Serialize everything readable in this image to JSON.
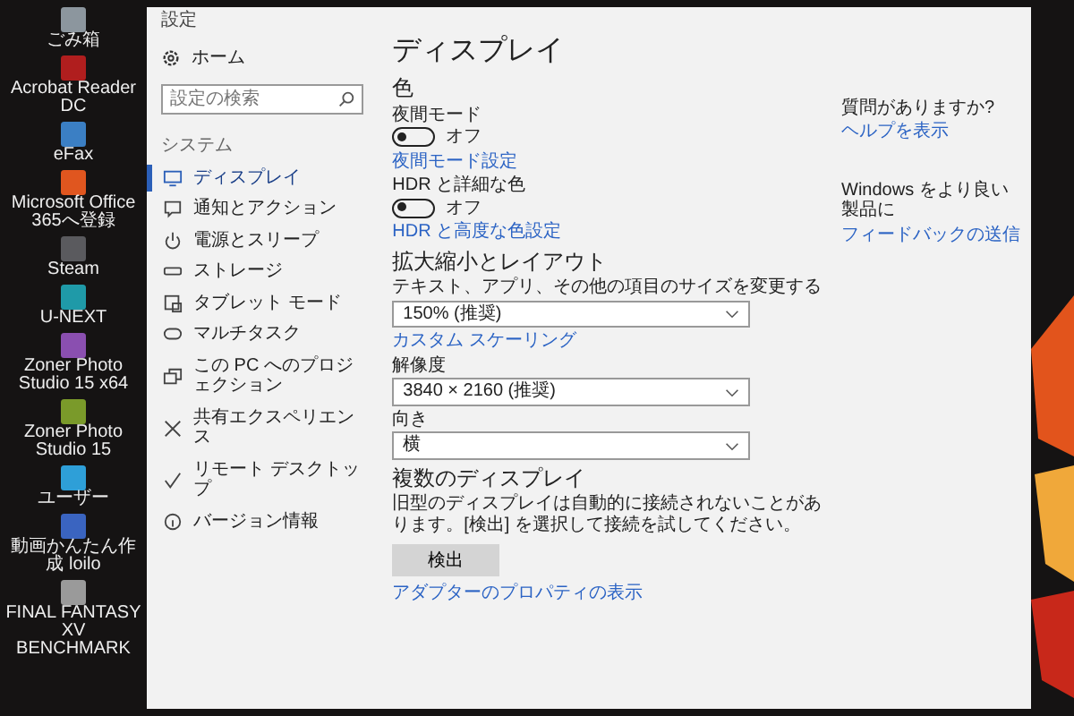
{
  "desktop_icons": [
    {
      "label": "ごみ箱",
      "color": "#8c969e"
    },
    {
      "label": "Acrobat Reader DC",
      "color": "#b01e1e"
    },
    {
      "label": "eFax",
      "color": "#3b7fc4"
    },
    {
      "label": "Microsoft Office 365へ登録",
      "color": "#e0561f"
    },
    {
      "label": "Steam",
      "color": "#5a5a5e"
    },
    {
      "label": "U-NEXT",
      "color": "#1f9aa8"
    },
    {
      "label": "Zoner Photo Studio 15 x64",
      "color": "#8a4fb0"
    },
    {
      "label": "Zoner Photo Studio 15",
      "color": "#7a9a2a"
    },
    {
      "label": "ユーザー",
      "color": "#2e9fd8"
    },
    {
      "label": "動画かんたん作成 loilo",
      "color": "#3a64c0"
    },
    {
      "label": "FINAL FANTASY XV BENCHMARK",
      "color": "#9a9a9a"
    }
  ],
  "window": {
    "title": "設定"
  },
  "sidebar": {
    "home": "ホーム",
    "search": {
      "placeholder": "設定の検索"
    },
    "section": "システム",
    "items": [
      {
        "label": "ディスプレイ",
        "selected": true
      },
      {
        "label": "通知とアクション",
        "selected": false
      },
      {
        "label": "電源とスリープ",
        "selected": false
      },
      {
        "label": "ストレージ",
        "selected": false
      },
      {
        "label": "タブレット モード",
        "selected": false
      },
      {
        "label": "マルチタスク",
        "selected": false
      },
      {
        "label": "この PC へのプロジェクション",
        "selected": false
      },
      {
        "label": "共有エクスペリエンス",
        "selected": false
      },
      {
        "label": "リモート デスクトップ",
        "selected": false
      },
      {
        "label": "バージョン情報",
        "selected": false
      }
    ]
  },
  "main": {
    "title": "ディスプレイ",
    "color_heading": "色",
    "toggles": [
      {
        "label": "夜間モード",
        "on": false,
        "state": "オフ",
        "link": "夜間モード設定"
      },
      {
        "label": "HDR と詳細な色",
        "on": false,
        "state": "オフ",
        "link": "HDR と高度な色設定"
      }
    ],
    "scale_heading": "拡大縮小とレイアウト",
    "scale": {
      "label": "テキスト、アプリ、その他の項目のサイズを変更する",
      "value": "150% (推奨)"
    },
    "custom_scaling_link": "カスタム スケーリング",
    "resolution": {
      "label": "解像度",
      "value": "3840 × 2160 (推奨)"
    },
    "orientation": {
      "label": "向き",
      "value": "横"
    },
    "multi_heading": "複数のディスプレイ",
    "multi_text": "旧型のディスプレイは自動的に接続されないことがあります。[検出] を選択して接続を試してください。",
    "detect_button": "検出",
    "adapter_link": "アダプターのプロパティの表示"
  },
  "aside": {
    "question": "質問がありますか?",
    "help_link": "ヘルプを表示",
    "improve": "Windows をより良い製品に",
    "feedback_link": "フィードバックの送信"
  }
}
